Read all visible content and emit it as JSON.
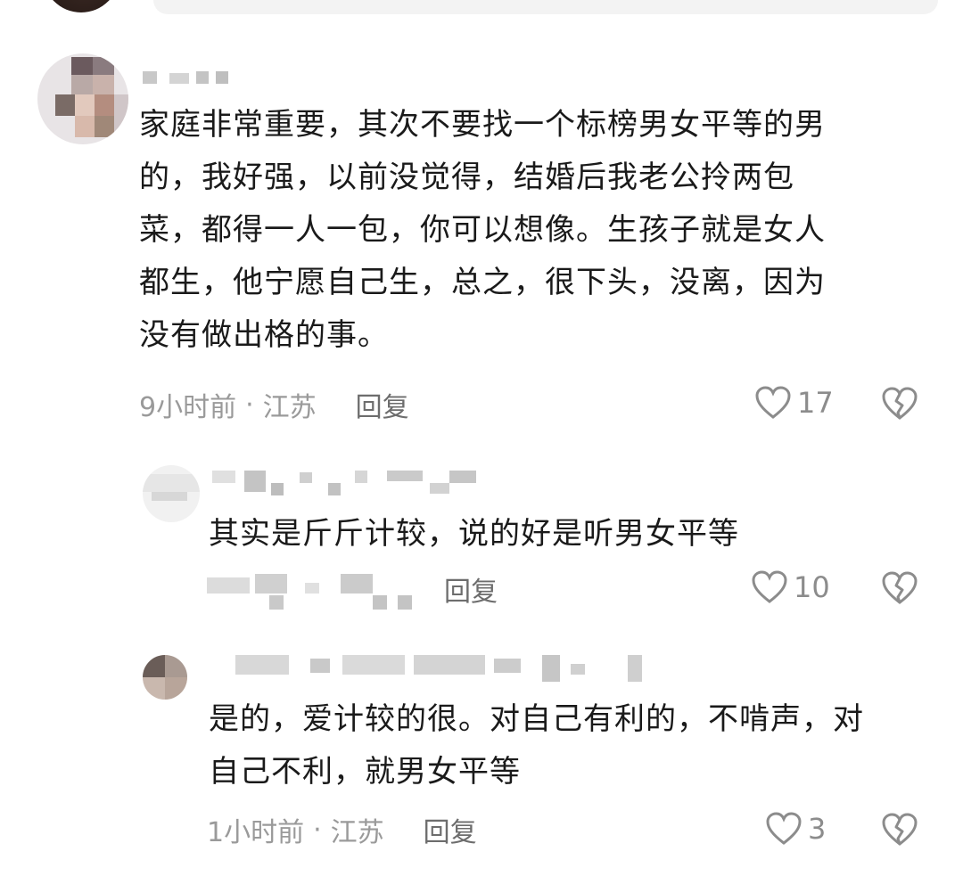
{
  "comments": [
    {
      "text": "家庭非常重要，其次不要找一个标榜男女平等的男\n的，我好强，以前没觉得，结婚后我老公拎两包\n菜，都得一人一包，你可以想像。生孩子就是女人\n都生，他宁愿自己生，总之，很下头，没离，因为\n没有做出格的事。",
      "time": "9小时前",
      "location": "江苏",
      "reply_label": "回复",
      "likes": "17"
    },
    {
      "text": "其实是斤斤计较，说的好是听男女平等",
      "reply_label": "回复",
      "likes": "10"
    },
    {
      "text": "是的，爱计较的很。对自己有利的，不啃声，对\n自己不利，就男女平等",
      "time": "1小时前",
      "location": "江苏",
      "reply_label": "回复",
      "likes": "3"
    }
  ],
  "separator": "·",
  "icons": {
    "like": "heart-outline-icon",
    "dislike": "broken-heart-icon"
  },
  "colors": {
    "text": "#1a1a1a",
    "meta": "#9a9a9a",
    "icon": "#8c8c8c"
  }
}
